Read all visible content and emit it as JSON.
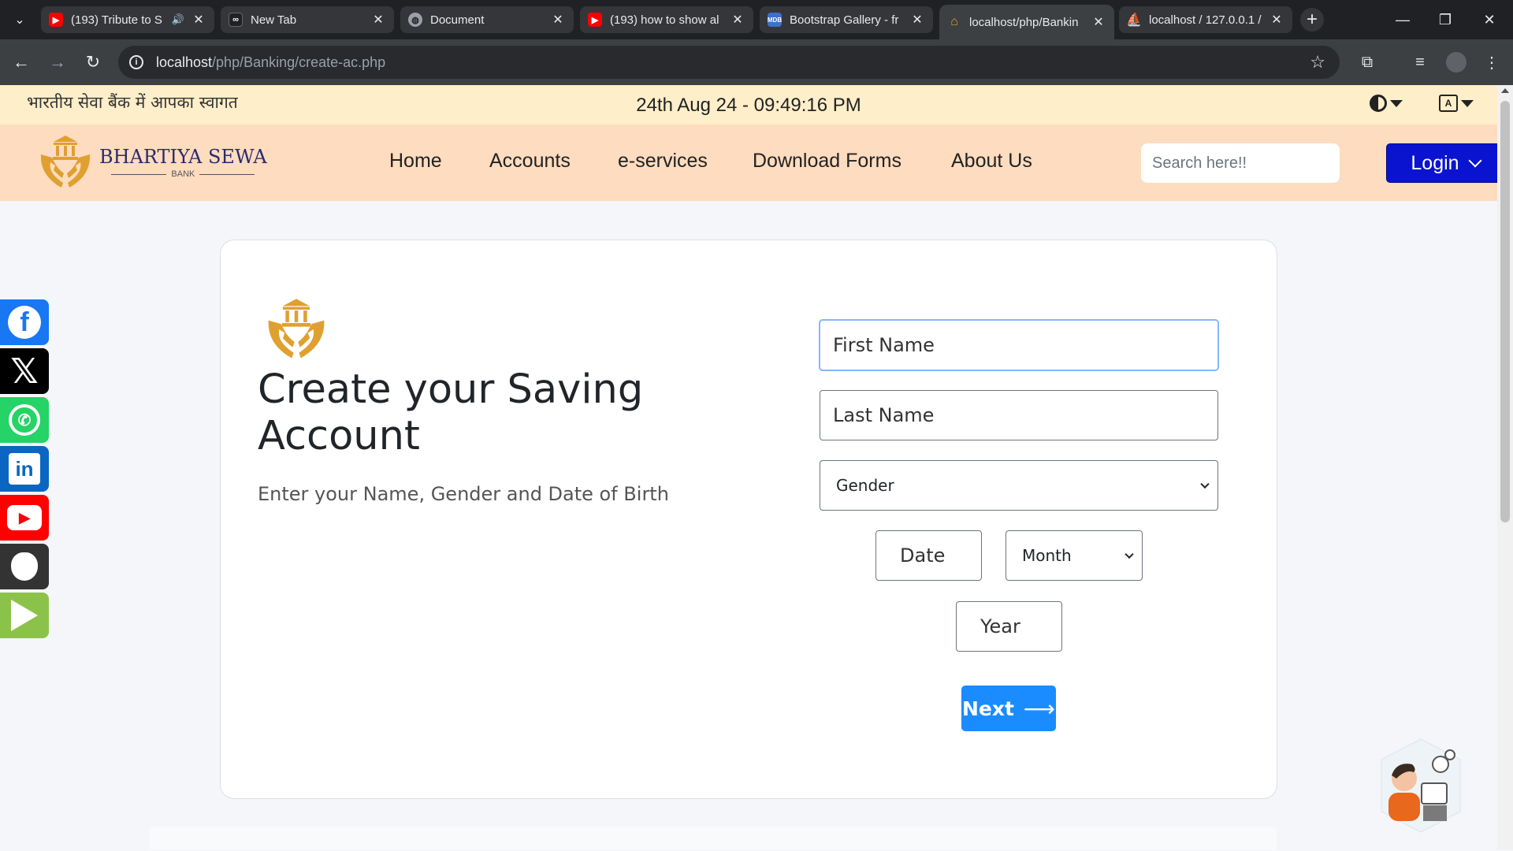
{
  "browser": {
    "tabs": [
      {
        "title": "(193) Tribute to S",
        "icon": "youtube-icon",
        "color": "#ff0000",
        "audio": true
      },
      {
        "title": "New Tab",
        "icon": "infinity-icon",
        "color": "#202124"
      },
      {
        "title": "Document",
        "icon": "globe-icon",
        "color": "#9aa0a6"
      },
      {
        "title": "(193) how to show al",
        "icon": "youtube-icon",
        "color": "#ff0000"
      },
      {
        "title": "Bootstrap Gallery - fr",
        "icon": "mdb-icon",
        "color": "#3b71ca"
      },
      {
        "title": "localhost/php/Bankin",
        "icon": "bank-icon",
        "color": "#e0a030",
        "active": true
      },
      {
        "title": "localhost / 127.0.0.1 /",
        "icon": "phpmyadmin-icon",
        "color": "#f29111"
      }
    ],
    "url_host": "localhost",
    "url_path": "/php/Banking/create-ac.php"
  },
  "topbar": {
    "greeting": "भारतीय सेवा बैंक में आपका स्वागत",
    "datetime": "24th Aug 24 - 09:49:16 PM"
  },
  "navbar": {
    "brand_name": "BHARTIYA SEWA",
    "brand_sub": "BANK",
    "links": [
      "Home",
      "Accounts",
      "e-services",
      "Download Forms",
      "About Us"
    ],
    "search_placeholder": "Search here!!",
    "login_label": "Login"
  },
  "form": {
    "title": "Create your Saving Account",
    "subtitle": "Enter your Name, Gender and Date of Birth",
    "first_name_placeholder": "First Name",
    "last_name_placeholder": "Last Name",
    "gender_selected": "Gender",
    "date_placeholder": "Date",
    "month_selected": "Month",
    "year_placeholder": "Year",
    "next_label": "Next"
  },
  "social": [
    {
      "name": "facebook-icon",
      "color": "#1877f2"
    },
    {
      "name": "x-icon",
      "color": "#000000"
    },
    {
      "name": "whatsapp-icon",
      "color": "#25d366"
    },
    {
      "name": "linkedin-icon",
      "color": "#0a66c2"
    },
    {
      "name": "youtube-icon",
      "color": "#ff0000"
    },
    {
      "name": "apple-icon",
      "color": "#333333"
    },
    {
      "name": "google-play-icon",
      "color": "#8bc34a"
    }
  ],
  "colors": {
    "topbar_bg": "#feeec9",
    "navbar_bg": "#fedcbf",
    "login_bg": "#0a14d0",
    "next_bg": "#1a8cff",
    "logo_gold": "#e0a030"
  }
}
